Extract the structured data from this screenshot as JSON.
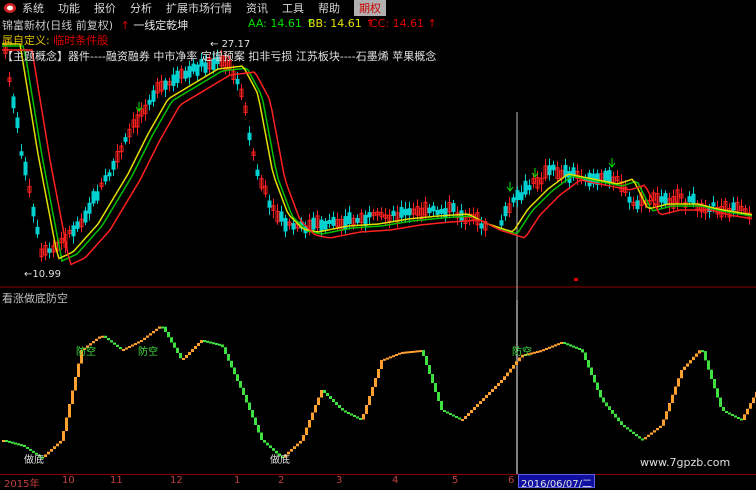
{
  "menu": {
    "items": [
      "系统",
      "功能",
      "报价",
      "分析",
      "扩展市场行情",
      "资讯",
      "工具",
      "帮助",
      "期权"
    ],
    "active_index": 8
  },
  "header": {
    "title": "锦富新材(日线 前复权)",
    "strategy": "一线定乾坤",
    "indicators": [
      {
        "label": "AA: 14.61",
        "color": "#00e000"
      },
      {
        "label": "BB: 14.61",
        "color": "#e0e000"
      },
      {
        "label": "CC: 14.61",
        "color": "#e00000"
      }
    ],
    "custom_prefix": "属自定义:",
    "custom_condition": "临时条件股",
    "concepts": "【主题概念】器件----融资融券 中市净率 定增预案 扣非亏损 江苏板块----石墨烯 苹果概念"
  },
  "price_panel": {
    "high_label": "27.17",
    "low_label": "10.99"
  },
  "osc_panel": {
    "title": "看涨做底防空",
    "labels": {
      "fangkong": "防空",
      "zuodi": "做底"
    }
  },
  "time_axis": {
    "ticks": [
      "2015年",
      "10",
      "11",
      "12",
      "1",
      "2",
      "3",
      "4",
      "5",
      "6"
    ],
    "cursor_date": "2016/06/07/二"
  },
  "watermark": "www.7gpzb.com",
  "colors": {
    "up": "#ff2020",
    "down": "#00d0d0",
    "green": "#40e040",
    "orange": "#ffa030",
    "ma_red": "#ff2020",
    "ma_yellow": "#e0e000",
    "ma_green": "#00c000"
  }
}
